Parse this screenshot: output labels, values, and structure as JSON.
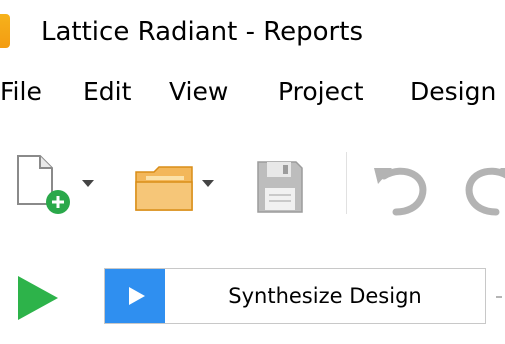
{
  "window": {
    "title": "Lattice Radiant - Reports",
    "app_icon": "lattice-app-icon"
  },
  "menu": {
    "items": [
      "File",
      "Edit",
      "View",
      "Project",
      "Design"
    ]
  },
  "toolbar": {
    "buttons": [
      {
        "name": "new-file",
        "icon": "new-file-icon"
      },
      {
        "name": "open-folder",
        "icon": "folder-open-icon"
      },
      {
        "name": "save",
        "icon": "save-icon"
      },
      {
        "name": "undo",
        "icon": "undo-icon"
      },
      {
        "name": "redo",
        "icon": "redo-icon"
      }
    ]
  },
  "flow": {
    "run_icon": "play-icon",
    "step_label": "Synthesize Design",
    "colors": {
      "run": "#2db34a",
      "step_icon_bg": "#2f8ff0"
    }
  }
}
